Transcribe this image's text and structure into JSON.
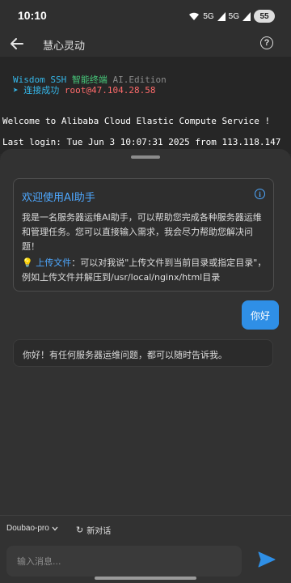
{
  "status_bar": {
    "time": "10:10",
    "signal_labels": [
      "5G",
      "5G"
    ],
    "battery": "55"
  },
  "app_bar": {
    "title": "慧心灵动",
    "back_icon": "arrow-left-icon",
    "help_icon": "help-circle-icon",
    "help_glyph": "?"
  },
  "terminal": {
    "brand": "Wisdom SSH",
    "brand_cn": "智能终端",
    "edition": "AI.Edition",
    "connected_arrow": "➤",
    "connected_text": "连接成功",
    "host": "root@47.104.28.58",
    "welcome_line": "Welcome to Alibaba Cloud Elastic Compute Service !",
    "last_login": "Last login: Tue Jun  3 10:07:31 2025 from 113.118.147"
  },
  "assistant": {
    "welcome_title": "欢迎使用AI助手",
    "info_icon": "info-icon",
    "info_glyph": "i",
    "welcome_body": "我是一名服务器运维AI助手，可以帮助您完成各种服务器运维和管理任务。您可以直接输入需求，我会尽力帮助您解决问题！",
    "tip_icon": "💡",
    "tip_link": "上传文件",
    "tip_text": "：可以对我说\"上传文件到当前目录或指定目录\"，例如上传文件并解压到/usr/local/nginx/html目录",
    "messages": [
      {
        "role": "user",
        "text": "你好"
      },
      {
        "role": "assistant",
        "text": "你好！有任何服务器运维问题，都可以随时告诉我。"
      }
    ]
  },
  "composer": {
    "model": "Doubao-pro",
    "new_chat_icon": "↻",
    "new_chat_label": "新对话",
    "input_placeholder": "输入消息...",
    "send_icon": "send-icon"
  },
  "colors": {
    "accent": "#2f8fe6",
    "link": "#4ea8ff",
    "terminal_cyan": "#35b6e8",
    "terminal_green": "#47c77a",
    "terminal_red": "#ff6b6b"
  }
}
